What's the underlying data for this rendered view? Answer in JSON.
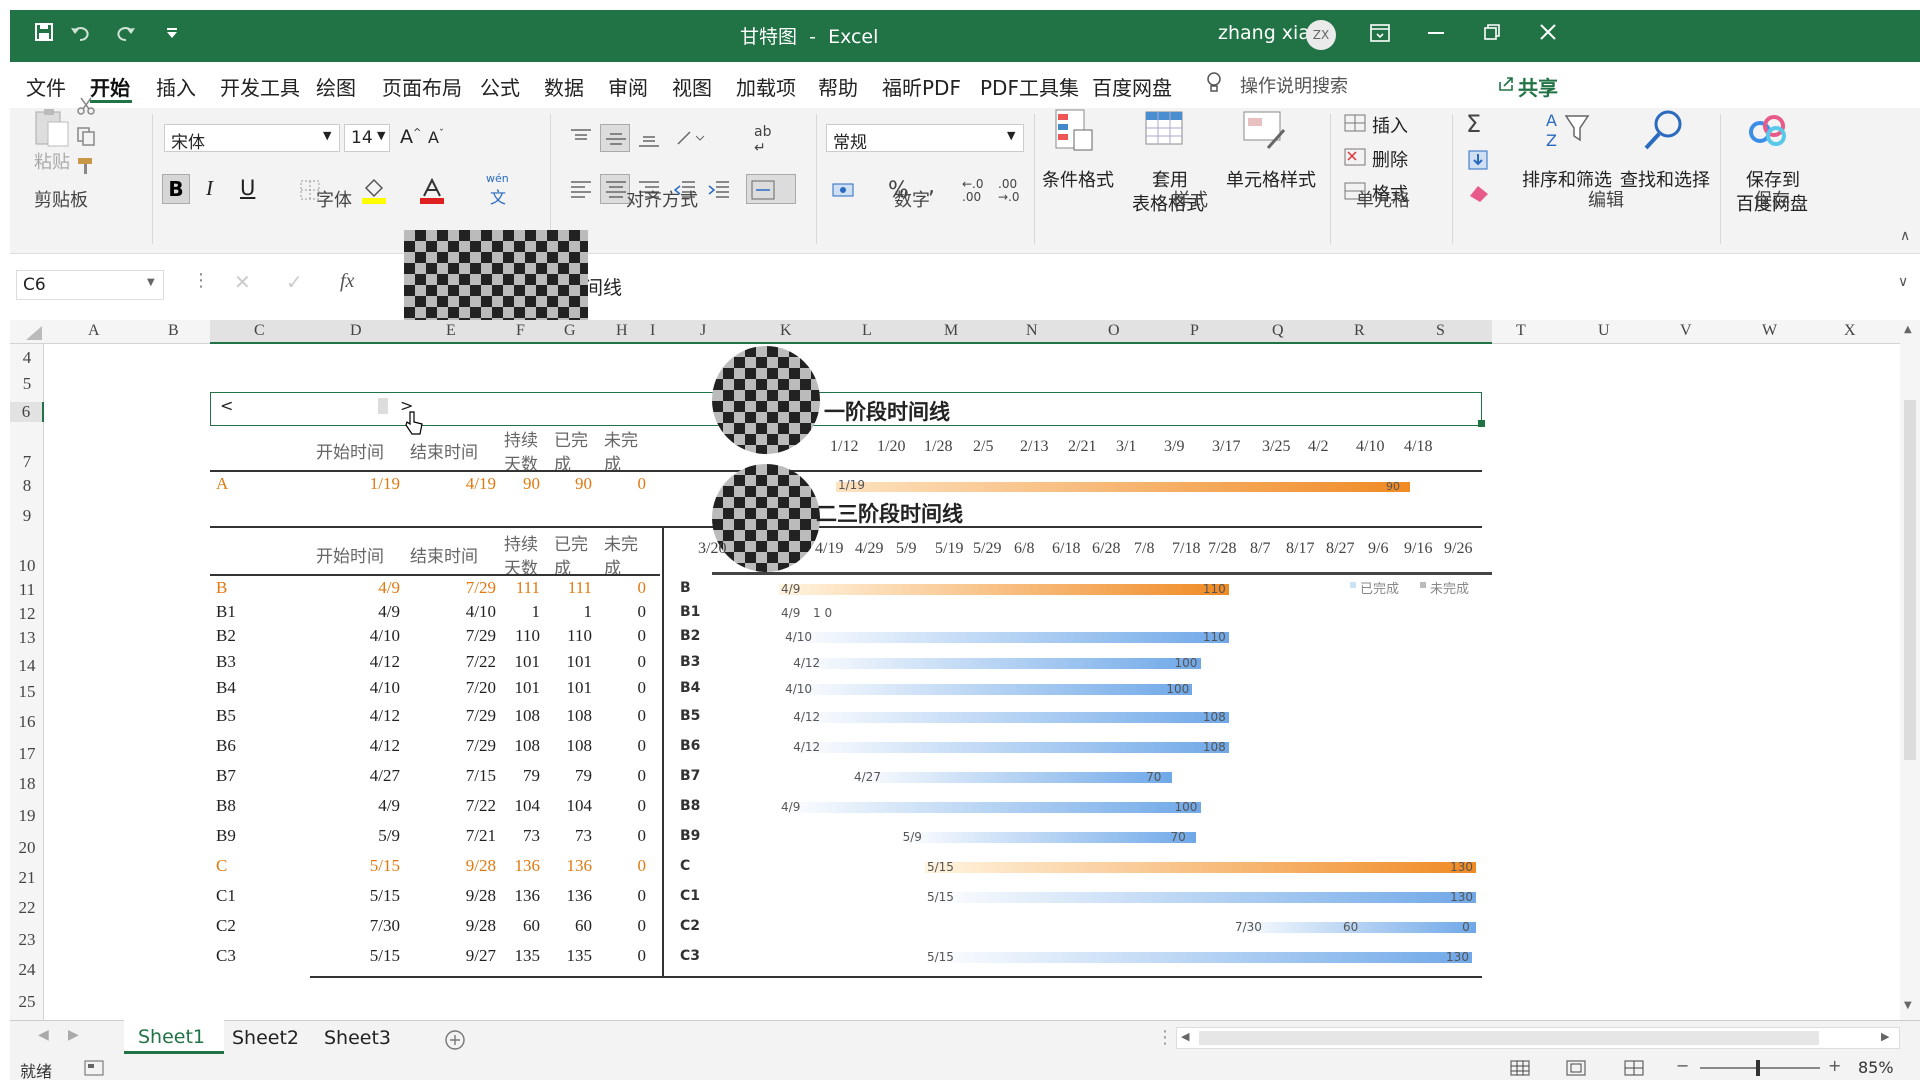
{
  "title": {
    "doc": "甘特图",
    "sep": "-",
    "app": "Excel",
    "user": "zhang xiao",
    "avatar": "ZX"
  },
  "menu": [
    "文件",
    "开始",
    "插入",
    "开发工具",
    "绘图",
    "页面布局",
    "公式",
    "数据",
    "审阅",
    "视图",
    "加载项",
    "帮助",
    "福昕PDF",
    "PDF工具集",
    "百度网盘"
  ],
  "search_hint": "操作说明搜索",
  "share": "共享",
  "ribbon": {
    "paste": "粘贴",
    "clipboard": "剪贴板",
    "font_name": "宋体",
    "font_size": "14",
    "font_group": "字体",
    "align_group": "对齐方式",
    "number_format": "常规",
    "number_group": "数字",
    "cond_format": "条件格式",
    "table_format_1": "套用",
    "table_format_2": "表格格式",
    "cell_styles": "单元格样式",
    "styles_group": "样式",
    "insert": "插入",
    "delete": "删除",
    "format": "格式",
    "cells_group": "单元格",
    "sort_filter": "排序和筛选",
    "find_select": "查找和选择",
    "edit_group": "编辑",
    "save_baidu_1": "保存到",
    "save_baidu_2": "百度网盘",
    "save_group": "保存",
    "bold": "B",
    "italic": "I",
    "underline": "U",
    "wen": "wén",
    "wen2": "文",
    "percent": "%",
    "comma": ","
  },
  "formula": {
    "namebox": "C6",
    "fx": "fx",
    "content": "间线"
  },
  "columns": [
    "A",
    "B",
    "C",
    "D",
    "E",
    "F",
    "G",
    "H",
    "I",
    "J",
    "K",
    "L",
    "M",
    "N",
    "O",
    "P",
    "Q",
    "R",
    "S",
    "T",
    "U",
    "V",
    "W",
    "X"
  ],
  "rows": [
    "4",
    "5",
    "6",
    "7",
    "8",
    "9",
    "10",
    "11",
    "12",
    "13",
    "14",
    "15",
    "16",
    "17",
    "18",
    "19",
    "20",
    "21",
    "22",
    "23",
    "24",
    "25"
  ],
  "scroll_prev": "<",
  "scroll_next": ">",
  "headers": {
    "start": "开始时间",
    "end": "结束时间",
    "dur1": "持续",
    "dur2": "天数",
    "done1": "已完",
    "done2": "成",
    "todo1": "未完",
    "todo2": "成"
  },
  "phase_a": {
    "title": "一阶段时间线",
    "row": {
      "name": "A",
      "start": "1/19",
      "end": "4/19",
      "dur": "90",
      "done": "90",
      "todo": "0"
    },
    "axis": [
      "1/12",
      "1/20",
      "1/28",
      "2/5",
      "2/13",
      "2/21",
      "3/1",
      "3/9",
      "3/17",
      "3/25",
      "4/2",
      "4/10",
      "4/18"
    ],
    "bar": {
      "start_label": "1/19",
      "value": "90"
    }
  },
  "phase_b": {
    "title": "二三阶段时间线",
    "axis": [
      "3/20",
      "4/19",
      "4/29",
      "5/9",
      "5/19",
      "5/29",
      "6/8",
      "6/18",
      "6/28",
      "7/8",
      "7/18",
      "7/28",
      "8/7",
      "8/17",
      "8/27",
      "9/6",
      "9/16",
      "9/26"
    ],
    "legend": [
      "已完成",
      "未完成"
    ],
    "rows": [
      {
        "name": "B",
        "start": "4/9",
        "end": "7/29",
        "dur": "111",
        "done": "111",
        "todo": "0",
        "label_start": "4/9",
        "label_val": "110",
        "main": true
      },
      {
        "name": "B1",
        "start": "4/9",
        "end": "4/10",
        "dur": "1",
        "done": "1",
        "todo": "0",
        "label_start": "4/9",
        "label_val": "1  0",
        "main": false
      },
      {
        "name": "B2",
        "start": "4/10",
        "end": "7/29",
        "dur": "110",
        "done": "110",
        "todo": "0",
        "label_start": "4/10",
        "label_val": "110",
        "main": false
      },
      {
        "name": "B3",
        "start": "4/12",
        "end": "7/22",
        "dur": "101",
        "done": "101",
        "todo": "0",
        "label_start": "4/12",
        "label_val": "100",
        "main": false
      },
      {
        "name": "B4",
        "start": "4/10",
        "end": "7/20",
        "dur": "101",
        "done": "101",
        "todo": "0",
        "label_start": "4/10",
        "label_val": "100",
        "main": false
      },
      {
        "name": "B5",
        "start": "4/12",
        "end": "7/29",
        "dur": "108",
        "done": "108",
        "todo": "0",
        "label_start": "4/12",
        "label_val": "108",
        "main": false
      },
      {
        "name": "B6",
        "start": "4/12",
        "end": "7/29",
        "dur": "108",
        "done": "108",
        "todo": "0",
        "label_start": "4/12",
        "label_val": "108",
        "main": false
      },
      {
        "name": "B7",
        "start": "4/27",
        "end": "7/15",
        "dur": "79",
        "done": "79",
        "todo": "0",
        "label_start": "4/27",
        "label_val": "70",
        "main": false
      },
      {
        "name": "B8",
        "start": "4/9",
        "end": "7/22",
        "dur": "104",
        "done": "104",
        "todo": "0",
        "label_start": "4/9",
        "label_val": "100",
        "main": false
      },
      {
        "name": "B9",
        "start": "5/9",
        "end": "7/21",
        "dur": "73",
        "done": "73",
        "todo": "0",
        "label_start": "5/9",
        "label_val": "70",
        "main": false
      },
      {
        "name": "C",
        "start": "5/15",
        "end": "9/28",
        "dur": "136",
        "done": "136",
        "todo": "0",
        "label_start": "5/15",
        "label_val": "130",
        "main": true
      },
      {
        "name": "C1",
        "start": "5/15",
        "end": "9/28",
        "dur": "136",
        "done": "136",
        "todo": "0",
        "label_start": "5/15",
        "label_val": "130",
        "main": false
      },
      {
        "name": "C2",
        "start": "7/30",
        "end": "9/28",
        "dur": "60",
        "done": "60",
        "todo": "0",
        "label_start": "7/30",
        "label_val": "60",
        "label_zero": "0",
        "main": false
      },
      {
        "name": "C3",
        "start": "5/15",
        "end": "9/27",
        "dur": "135",
        "done": "135",
        "todo": "0",
        "label_start": "5/15",
        "label_val": "130",
        "main": false
      }
    ]
  },
  "sheets": [
    "Sheet1",
    "Sheet2",
    "Sheet3"
  ],
  "status": {
    "ready": "就绪",
    "zoom": "85%"
  },
  "colors": {
    "green": "#217346",
    "orange": "#f08a24",
    "blue": "#6fa8e8"
  }
}
